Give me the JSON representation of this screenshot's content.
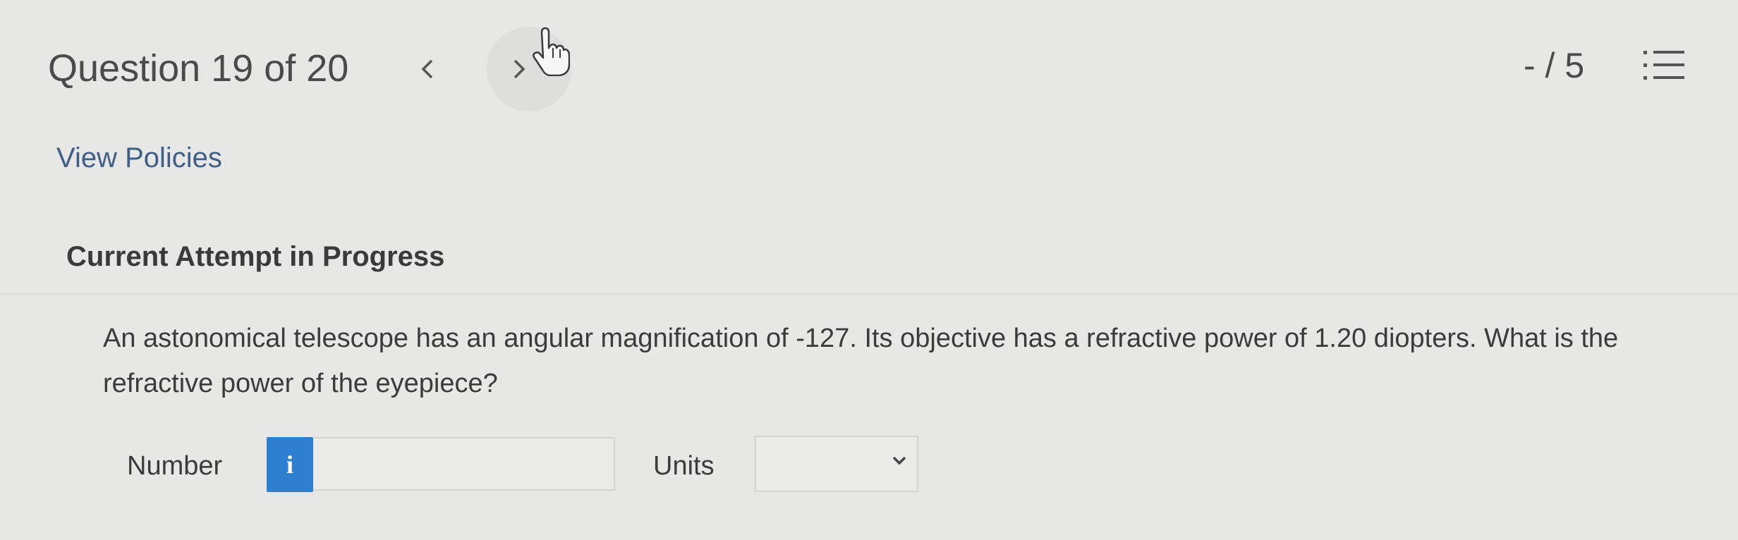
{
  "header": {
    "question_counter": "Question 19 of 20",
    "prev_label": "<",
    "next_label": ">",
    "score": "- / 5"
  },
  "policies_link": "View Policies",
  "attempt_heading": "Current Attempt in Progress",
  "question_text": "An astonomical telescope has an angular magnification of -127. Its objective has a refractive power of 1.20 diopters. What is the refractive power of the eyepiece?",
  "answer": {
    "number_label": "Number",
    "info_icon_text": "i",
    "number_value": "",
    "units_label": "Units",
    "units_value": ""
  },
  "icons": {
    "prev": "chevron-left-icon",
    "next": "chevron-right-icon",
    "list": "list-icon",
    "info": "info-icon",
    "dropdown": "chevron-down-icon",
    "cursor": "hand-pointer-icon"
  },
  "colors": {
    "background": "#e7e7e6",
    "link": "#3f5f86",
    "info_button": "#2f7fd1"
  }
}
